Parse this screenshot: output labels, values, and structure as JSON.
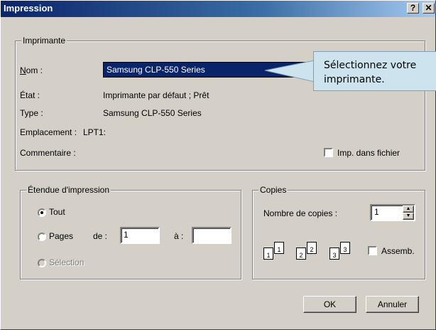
{
  "window": {
    "title": "Impression",
    "help_glyph": "?",
    "close_glyph": "✕"
  },
  "printer_group": {
    "legend": "Imprimante",
    "name_label": "Nom :",
    "name_value": "Samsung CLP-550 Series",
    "state_label": "État :",
    "state_value": "Imprimante par défaut ; Prêt",
    "type_label": "Type :",
    "type_value": "Samsung CLP-550 Series",
    "location_label": "Emplacement :",
    "location_value": "LPT1:",
    "comment_label": "Commentaire :",
    "print_to_file_label": "Imp. dans fichier"
  },
  "range_group": {
    "legend": "Étendue d'impression",
    "all_label": "Tout",
    "pages_label": "Pages",
    "from_label": "de :",
    "from_value": "1",
    "to_label": "à :",
    "to_value": "",
    "selection_label": "Sélection"
  },
  "copies_group": {
    "legend": "Copies",
    "count_label": "Nombre de copies :",
    "count_value": "1",
    "collate_label": "Assemb.",
    "page_numbers": [
      "1",
      "1",
      "2",
      "2",
      "3",
      "3"
    ]
  },
  "buttons": {
    "ok": "OK",
    "cancel": "Annuler"
  },
  "callout": {
    "line1": "Sélectionnez votre",
    "line2": "imprimante."
  }
}
